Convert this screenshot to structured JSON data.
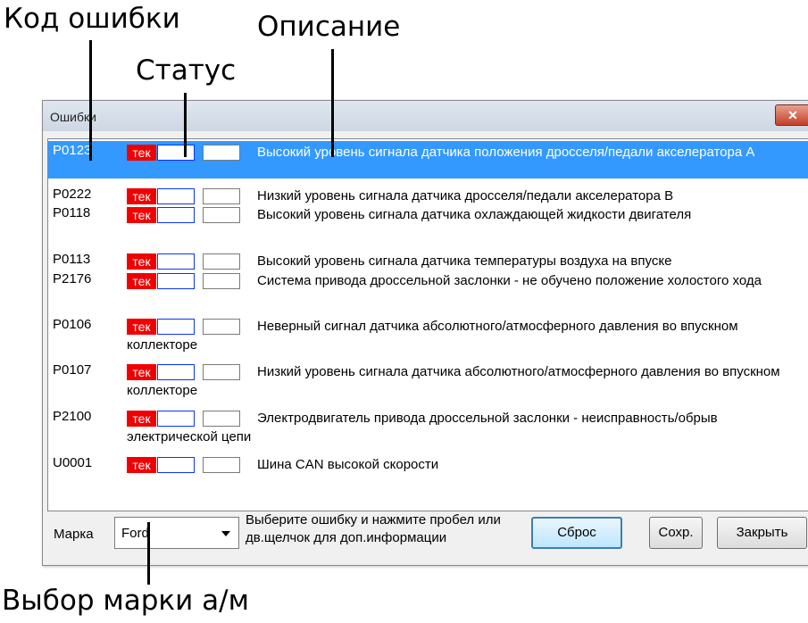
{
  "annotations": {
    "error_code": "Код ошибки",
    "description": "Описание",
    "status": "Статус",
    "brand_select": "Выбор марки а/м"
  },
  "dialog": {
    "title": "Ошибки",
    "close_glyph": "✕"
  },
  "errors": [
    {
      "code": "P0123",
      "status": "тек",
      "description": "Высокий уровень сигнала датчика положения дросселя/педали акселератора А",
      "selected": true
    },
    {
      "code": "P0222",
      "status": "тек",
      "description": "Низкий уровень сигнала датчика дросселя/педали акселератора В"
    },
    {
      "code": "P0118",
      "status": "тек",
      "description": "Высокий уровень сигнала датчика охлаждающей жидкости двигателя"
    },
    {
      "code": "P0113",
      "status": "тек",
      "description": "Высокий уровень сигнала датчика температуры воздуха на впуске"
    },
    {
      "code": "P2176",
      "status": "тек",
      "description": "Система привода дроссельной заслонки - не обучено положение холостого хода"
    },
    {
      "code": "P0106",
      "status": "тек",
      "description": "Неверный сигнал датчика абсолютного/атмосферного давления во впускном коллекторе"
    },
    {
      "code": "P0107",
      "status": "тек",
      "description": "Низкий уровень сигнала датчика абсолютного/атмосферного давления во впускном коллекторе"
    },
    {
      "code": "P2100",
      "status": "тек",
      "description": "Электродвигатель привода дроссельной заслонки - неисправность/обрыв электрической цепи"
    },
    {
      "code": "U0001",
      "status": "тек",
      "description": "Шина CAN высокой скорости"
    }
  ],
  "footer": {
    "brand_label": "Марка",
    "brand_value": "Ford",
    "hint": "Выберите ошибку и нажмите пробел или дв.щелчок для доп.информации",
    "reset_label": "Сброс",
    "save_label": "Сохр.",
    "close_label": "Закрыть"
  },
  "colors": {
    "selection": "#3399ff",
    "status_badge": "#f00000",
    "status_box_blue": "#0a32ff"
  }
}
